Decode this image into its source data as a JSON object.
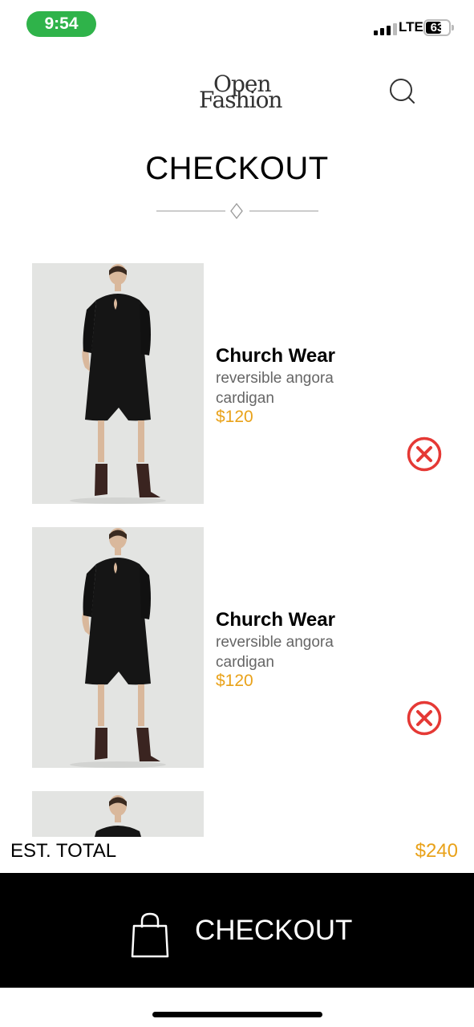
{
  "status_bar": {
    "time": "9:54",
    "network": "LTE",
    "battery": "63",
    "battery_level_percent": 63
  },
  "header": {
    "logo_line1": "Open",
    "logo_line2": "Fashion",
    "search_icon": "search-icon"
  },
  "page": {
    "title": "CHECKOUT"
  },
  "cart": {
    "items": [
      {
        "name": "Church Wear",
        "description": "reversible angora cardigan",
        "price": "$120",
        "remove_icon": "remove-circle-x-icon"
      },
      {
        "name": "Church Wear",
        "description": "reversible angora cardigan",
        "price": "$120",
        "remove_icon": "remove-circle-x-icon"
      }
    ]
  },
  "summary": {
    "total_label": "EST. TOTAL",
    "total_value": "$240"
  },
  "checkout_button": {
    "label": "CHECKOUT",
    "icon": "shopping-bag-icon"
  },
  "colors": {
    "accent_price": "#e9a21a",
    "remove_red": "#e53935",
    "time_pill": "#2fb34a",
    "checkout_bg": "#000000"
  }
}
